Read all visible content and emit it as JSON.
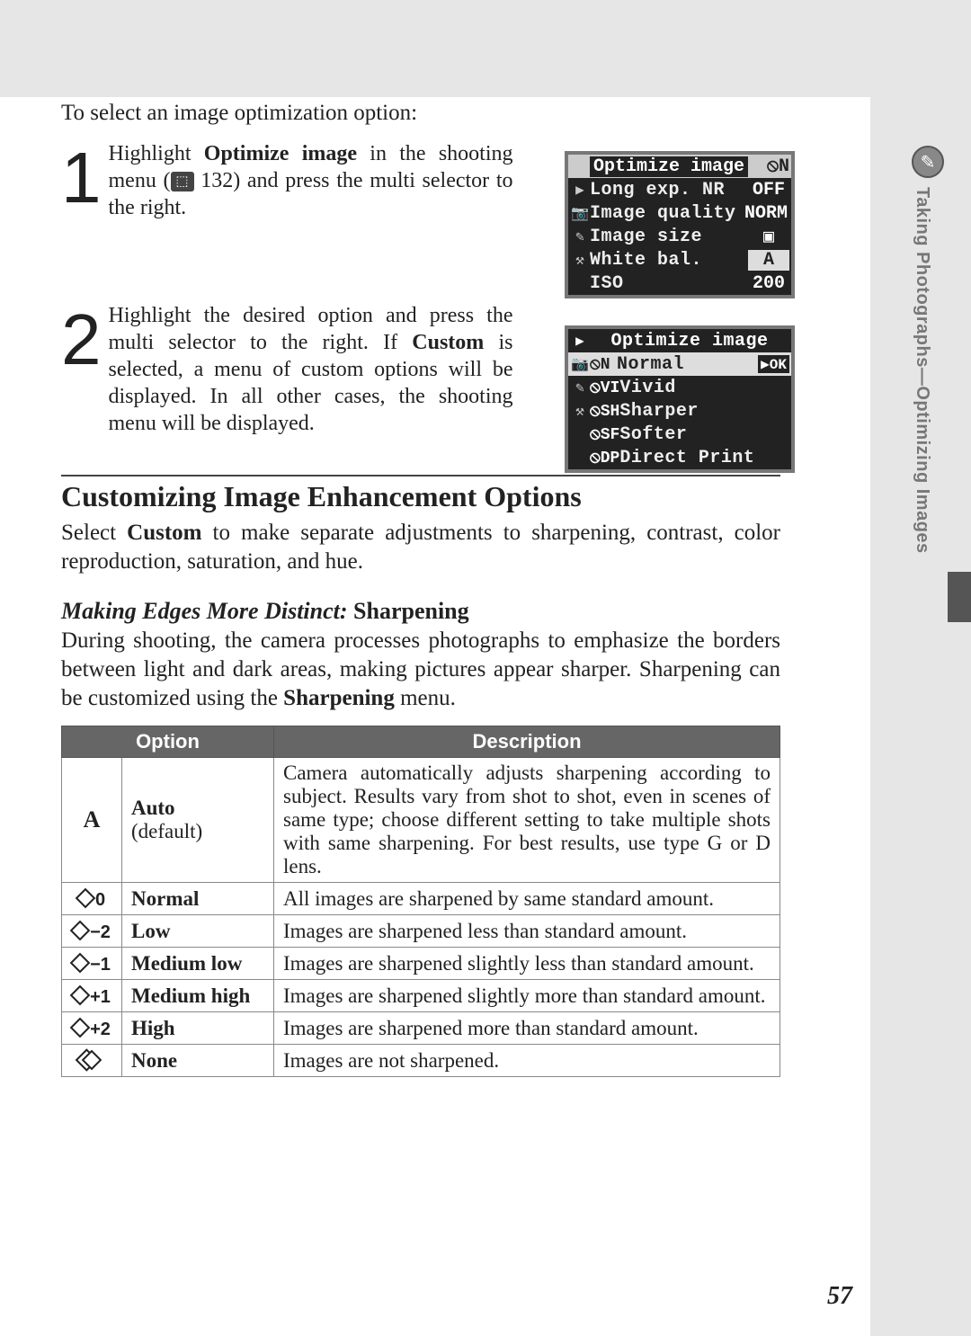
{
  "intro": "To select an image optimization option:",
  "steps": [
    {
      "num": "1",
      "pre": "Highlight ",
      "bold1": "Optimize image",
      "mid": " in the shooting menu (",
      "ref": "132",
      "post": ") and press the multi selector to the right."
    },
    {
      "num": "2",
      "pre": "Highlight the desired option and press the multi selector to the right.  If ",
      "bold1": "Custom",
      "post": " is selected, a menu of custom options will be displayed.  In all other cases, the shooting menu will be displayed."
    }
  ],
  "lcd1": {
    "title": "Optimize image",
    "title_badge": "N",
    "rows": [
      {
        "icon": "▶",
        "label": "Long exp. NR",
        "val": "OFF"
      },
      {
        "icon": "📷",
        "label": "Image quality",
        "val": "NORM"
      },
      {
        "icon": "✎",
        "label": "Image size",
        "val": "▣"
      },
      {
        "icon": "⚒",
        "label": "White bal.",
        "val": "A"
      },
      {
        "icon": "",
        "label": "ISO",
        "val": "200"
      }
    ]
  },
  "lcd2": {
    "title": "Optimize image",
    "rows": [
      {
        "code": "N",
        "label": "Normal",
        "sel": true,
        "ok": "▶OK"
      },
      {
        "code": "VI",
        "label": "Vivid"
      },
      {
        "code": "SH",
        "label": "Sharper"
      },
      {
        "code": "SF",
        "label": "Softer"
      },
      {
        "code": "DP",
        "label": "Direct Print"
      }
    ]
  },
  "section_title": "Customizing Image Enhancement Options",
  "section_body_pre": "Select ",
  "section_body_bold": "Custom",
  "section_body_post": " to make separate adjustments to sharpening, contrast, color reproduction, saturation, and hue.",
  "subhead_italic": "Making Edges More Distinct:",
  "subhead_bold": "Sharpening",
  "sharp_body_pre": "During shooting, the camera processes photographs to emphasize the borders between light and dark areas, making pictures appear sharper.  Sharpening can be customized using the ",
  "sharp_body_bold": "Sharpening",
  "sharp_body_post": " menu.",
  "table": {
    "h1": "Option",
    "h2": "Description",
    "rows": [
      {
        "sym": "A",
        "opt": "Auto",
        "def": "(default)",
        "desc": "Camera automatically adjusts sharpening according to subject.  Results vary from shot to shot, even in scenes of same type; choose different setting to take multiple shots with same sharpening.  For best results, use type G or D lens."
      },
      {
        "sym": "◇ 0",
        "opt": "Normal",
        "desc": "All images are sharpened by same standard amount."
      },
      {
        "sym": "◇−2",
        "opt": "Low",
        "desc": "Images are sharpened less than standard amount."
      },
      {
        "sym": "◇−1",
        "opt": "Medium low",
        "desc": "Images are sharpened slightly less than standard amount."
      },
      {
        "sym": "◇+1",
        "opt": "Medium high",
        "desc": "Images are sharpened slightly more than standard amount."
      },
      {
        "sym": "◇+2",
        "opt": "High",
        "desc": "Images are sharpened more than standard amount."
      },
      {
        "sym": "⃠",
        "opt": "None",
        "desc": "Images are not sharpened."
      }
    ]
  },
  "sidebar": "Taking Photographs—Optimizing Images",
  "page_number": "57"
}
